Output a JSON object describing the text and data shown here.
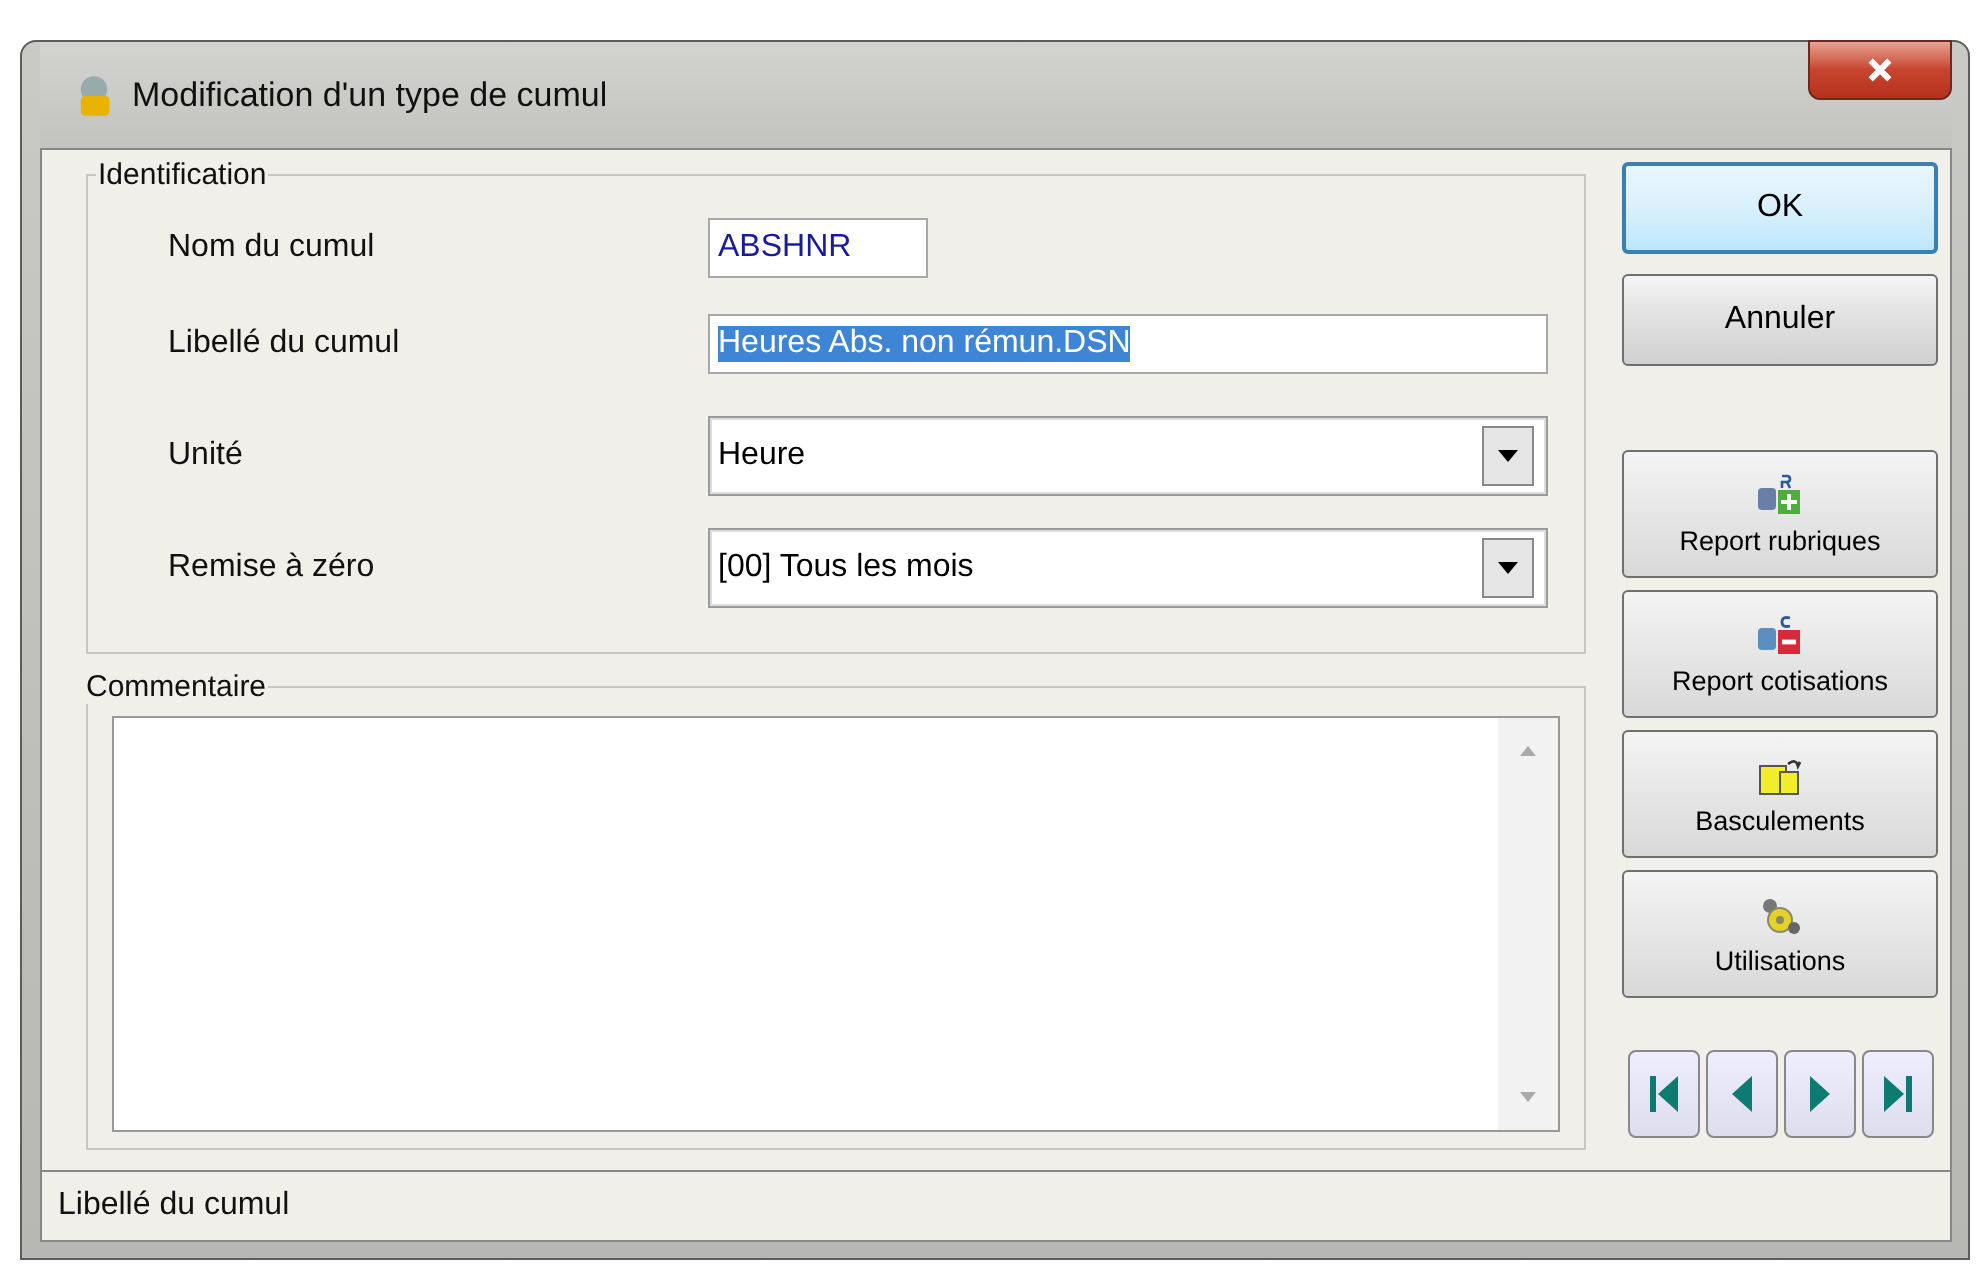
{
  "window": {
    "title": "Modification d'un type de cumul"
  },
  "identification": {
    "title": "Identification",
    "fields": [
      {
        "kind": "text",
        "label": "Nom du cumul",
        "value": "ABSHNR",
        "selected": false
      },
      {
        "kind": "text",
        "label": "Libellé du cumul",
        "value": "Heures Abs. non rémun.DSN",
        "selected": true
      },
      {
        "kind": "dropdown",
        "label": "Unité",
        "value": "Heure",
        "selected": false
      },
      {
        "kind": "dropdown",
        "label": "Remise à zéro",
        "value": "[00] Tous les mois",
        "selected": false
      }
    ]
  },
  "comment": {
    "title": "Commentaire"
  },
  "buttons": [
    {
      "label": "OK",
      "default": true
    },
    {
      "label": "Annuler",
      "default": false
    }
  ],
  "actions": [
    {
      "kind": "rubriques",
      "label": "Report rubriques"
    },
    {
      "kind": "cotisations",
      "label": "Report cotisations"
    },
    {
      "kind": "bascule",
      "label": "Basculements"
    },
    {
      "kind": "utilisations",
      "label": "Utilisations"
    }
  ],
  "navigation": [
    {
      "kind": "first"
    },
    {
      "kind": "prev"
    },
    {
      "kind": "next"
    },
    {
      "kind": "last"
    }
  ],
  "status_bar": {
    "text": "Libellé du cumul"
  }
}
